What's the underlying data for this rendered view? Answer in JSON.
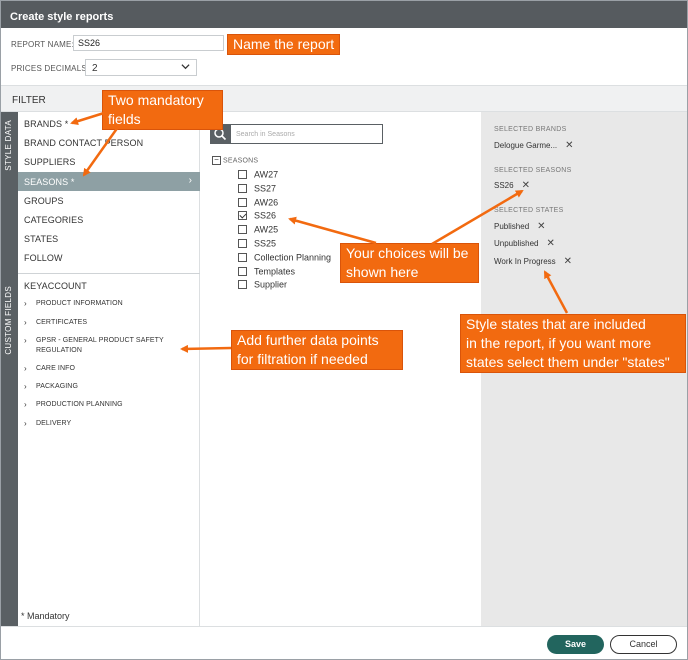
{
  "window": {
    "title": "Create style reports"
  },
  "report": {
    "name_label": "REPORT NAME:",
    "name_value": "SS26",
    "decimals_label": "PRICES DECIMALS:",
    "decimals_value": "2"
  },
  "filter": {
    "title": "FILTER"
  },
  "tabs": {
    "style_data": "STYLE DATA",
    "custom_fields": "CUSTOM FIELDS"
  },
  "style_data_items": [
    "BRANDS *",
    "BRAND CONTACT PERSON",
    "SUPPLIERS",
    "SEASONS *",
    "GROUPS",
    "CATEGORIES",
    "STATES",
    "FOLLOW"
  ],
  "active_item_arrow": "›",
  "custom_fields": {
    "top": "KEYACCOUNT",
    "items": [
      "PRODUCT INFORMATION",
      "CERTIFICATES",
      "GPSR - GENERAL PRODUCT SAFETY REGULATION",
      "CARE INFO",
      "PACKAGING",
      "PRODUCTION PLANNING",
      "DELIVERY"
    ]
  },
  "mandatory_note": "* Mandatory",
  "seasons_panel": {
    "search_placeholder": "Search in Seasons",
    "root_label": "SEASONS",
    "options": [
      {
        "label": "AW27",
        "checked": false
      },
      {
        "label": "SS27",
        "checked": false
      },
      {
        "label": "AW26",
        "checked": false
      },
      {
        "label": "SS26",
        "checked": true
      },
      {
        "label": "AW25",
        "checked": false
      },
      {
        "label": "SS25",
        "checked": false
      },
      {
        "label": "Collection Planning",
        "checked": false
      },
      {
        "label": "Templates",
        "checked": false
      },
      {
        "label": "Supplier",
        "checked": false
      }
    ]
  },
  "selected": {
    "brands_head": "SELECTED BRANDS",
    "brands_value": "Delogue Garme...",
    "seasons_head": "SELECTED SEASONS",
    "seasons_value": "SS26",
    "states_head": "SELECTED STATES",
    "states": [
      "Published",
      "Unpublished",
      "Work In Progress"
    ],
    "remove_glyph": "✕"
  },
  "buttons": {
    "save": "Save",
    "cancel": "Cancel"
  },
  "callouts": {
    "name": "Name the report",
    "mandatory_l1": "Two mandatory",
    "mandatory_l2": "fields",
    "choices_l1": "Your choices will be",
    "choices_l2": "shown here",
    "further_l1": "Add further data points",
    "further_l2": "for filtration if needed",
    "states_l1": "Style states that are included",
    "states_l2": "in  the report, if you want more",
    "states_l3": "states select them under \"states\""
  },
  "colors": {
    "accent": "#f26a10",
    "save": "#22655e",
    "titlebar": "#565b5f",
    "active_row": "#8ea0a4"
  },
  "icons": {
    "search": "search-icon",
    "chevron": "chevron-down-icon"
  }
}
